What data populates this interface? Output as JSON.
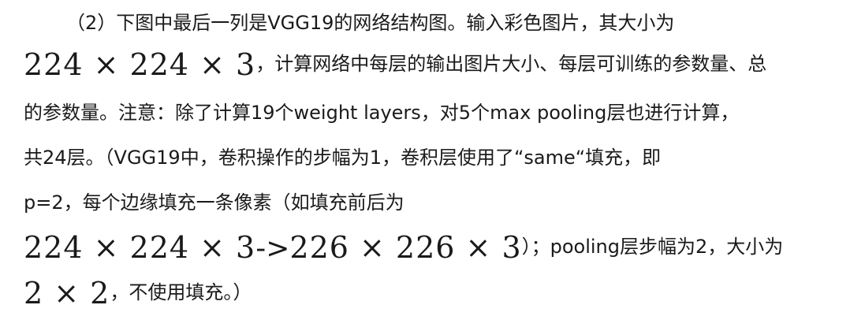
{
  "problem": {
    "line1": "（2）下图中最后一列是VGG19的网络结构图。输入彩色图片，其大小为",
    "line2_math": "224 × 224 × 3",
    "line2_text": "，计算网络中每层的输出图片大小、每层可训练的参数量、总",
    "line3": "的参数量。注意：除了计算19个weight layers，对5个max pooling层也进行计算，",
    "line4": "共24层。（VGG19中，卷积操作的步幅为1，卷积层使用了“same“填充，即",
    "line5": "p=2，每个边缘填充一条像素（如填充前后为",
    "line6_math_a": "224 × 224 × 3",
    "line6_arrow": "->",
    "line6_math_b": "226 × 226 × 3",
    "line6_text": "）；pooling层步幅为2，大小为",
    "line7_math": "2 × 2",
    "line7_text": "，不使用填充。）"
  }
}
